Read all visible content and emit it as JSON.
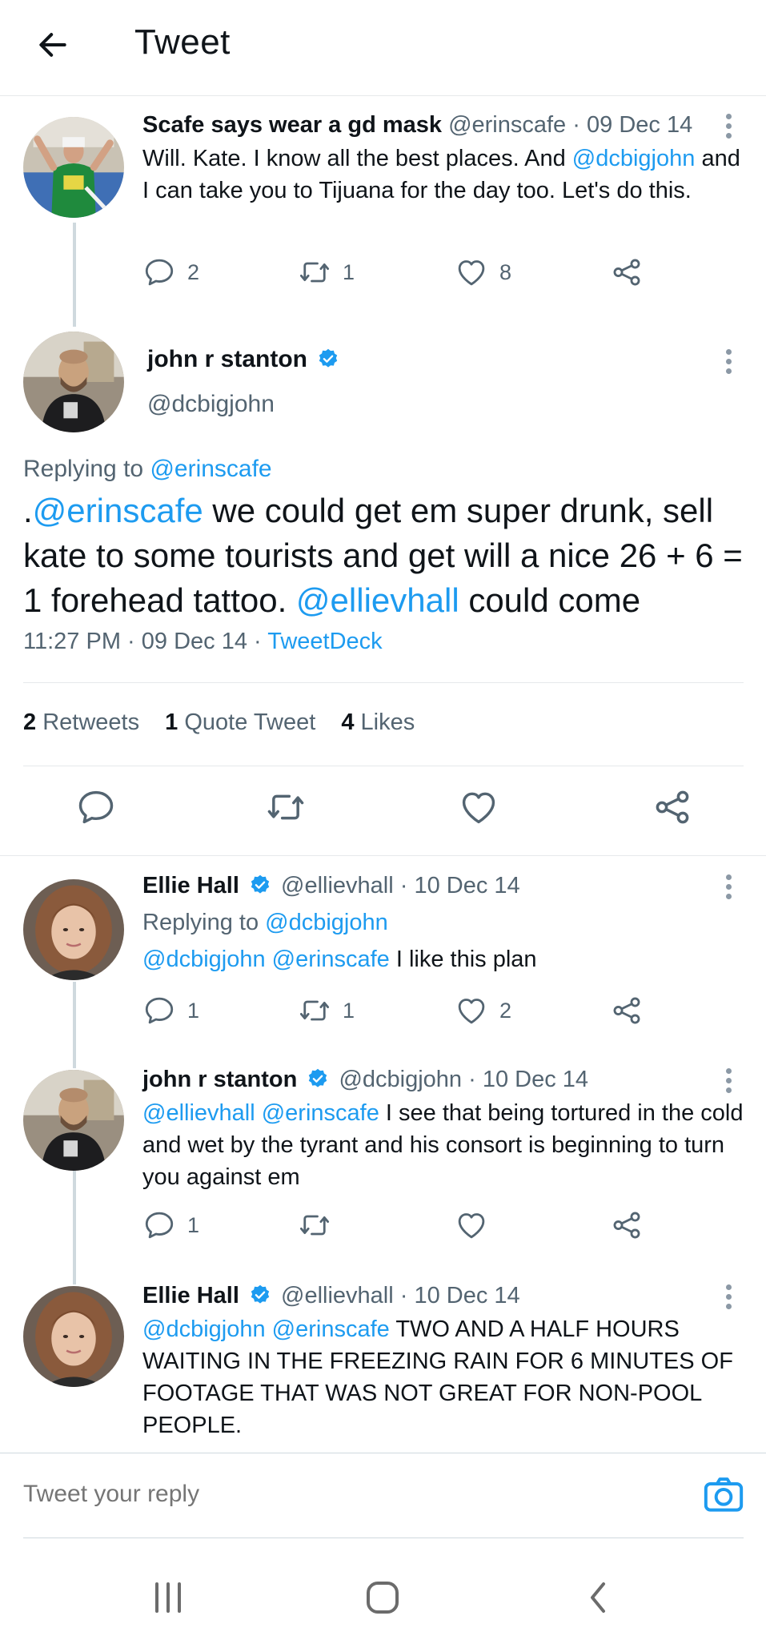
{
  "header": {
    "title": "Tweet"
  },
  "tweets": [
    {
      "name": "Scafe says wear a gd mask",
      "handle": "@erinscafe",
      "date": "09 Dec 14",
      "body_pre": "Will. Kate. I know all the best places. And ",
      "body_link": "@dcbigjohn",
      "body_post": " and I can take you to Tijuana for the day too. Let's do this.",
      "replies": "2",
      "retweets": "1",
      "likes": "8"
    },
    {
      "name": "Ellie Hall",
      "handle": "@ellievhall",
      "date": "10 Dec 14",
      "replying_label": "Replying to",
      "replying_to": "@dcbigjohn",
      "mention1": "@dcbigjohn",
      "mention2": "@erinscafe",
      "body": " I like this plan",
      "replies": "1",
      "retweets": "1",
      "likes": "2"
    },
    {
      "name": "john r stanton",
      "handle": "@dcbigjohn",
      "date": "10 Dec 14",
      "mention1": "@ellievhall",
      "mention2": "@erinscafe",
      "body": " I see that being tortured in the cold and wet by the tyrant and his consort is beginning to turn you against em",
      "replies": "1"
    },
    {
      "name": "Ellie Hall",
      "handle": "@ellievhall",
      "date": "10 Dec 14",
      "mention1": "@dcbigjohn",
      "mention2": "@erinscafe",
      "body": " TWO AND A HALF HOURS WAITING IN THE FREEZING RAIN FOR 6 MINUTES OF FOOTAGE THAT WAS NOT GREAT FOR NON-POOL PEOPLE."
    }
  ],
  "main_tweet": {
    "name": "john r stanton",
    "handle": "@dcbigjohn",
    "replying_label": "Replying to",
    "replying_to": "@erinscafe",
    "text_pre": ".",
    "text_link1": "@erinscafe",
    "text_mid": " we could get em super drunk, sell kate to some tourists and get will a nice 26 + 6 = 1 forehead tattoo. ",
    "text_link2": "@ellievhall",
    "text_post": " could come",
    "time": "11:27 PM",
    "date": "09 Dec 14",
    "source": "TweetDeck",
    "retweets_count": "2",
    "retweets_label": "Retweets",
    "quotes_count": "1",
    "quotes_label": "Quote Tweet",
    "likes_count": "4",
    "likes_label": "Likes"
  },
  "reply": {
    "placeholder": "Tweet your reply"
  },
  "colors": {
    "link": "#1d9bf0",
    "muted": "#536471",
    "text": "#0f1419",
    "divider": "#e6e9eb"
  },
  "icons": [
    "back-arrow-icon",
    "more-vertical-icon",
    "reply-icon",
    "retweet-icon",
    "like-icon",
    "share-icon",
    "verified-badge-icon",
    "camera-icon",
    "recent-apps-icon",
    "home-icon",
    "system-back-icon"
  ]
}
